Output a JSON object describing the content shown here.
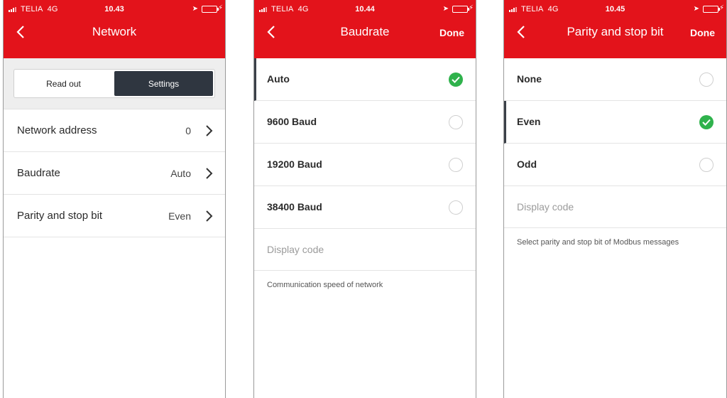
{
  "screens": [
    {
      "status": {
        "carrier": "TELIA",
        "network": "4G",
        "time": "10.43"
      },
      "title": "Network",
      "segments": [
        "Read out",
        "Settings"
      ],
      "rows": [
        {
          "label": "Network address",
          "value": "0"
        },
        {
          "label": "Baudrate",
          "value": "Auto"
        },
        {
          "label": "Parity and stop bit",
          "value": "Even"
        }
      ]
    },
    {
      "status": {
        "carrier": "TELIA",
        "network": "4G",
        "time": "10.44"
      },
      "title": "Baudrate",
      "done": "Done",
      "options": [
        {
          "label": "Auto",
          "selected": true
        },
        {
          "label": "9600 Baud",
          "selected": false
        },
        {
          "label": "19200 Baud",
          "selected": false
        },
        {
          "label": "38400 Baud",
          "selected": false
        }
      ],
      "display_code": "Display code",
      "hint": "Communication speed of network"
    },
    {
      "status": {
        "carrier": "TELIA",
        "network": "4G",
        "time": "10.45"
      },
      "title": "Parity and stop bit",
      "done": "Done",
      "options": [
        {
          "label": "None",
          "selected": false
        },
        {
          "label": "Even",
          "selected": true
        },
        {
          "label": "Odd",
          "selected": false
        }
      ],
      "display_code": "Display code",
      "hint": "Select parity and stop bit of Modbus messages"
    }
  ],
  "colors": {
    "header": "#e3131b",
    "segment_active": "#2f3640",
    "check": "#2fb24c"
  }
}
